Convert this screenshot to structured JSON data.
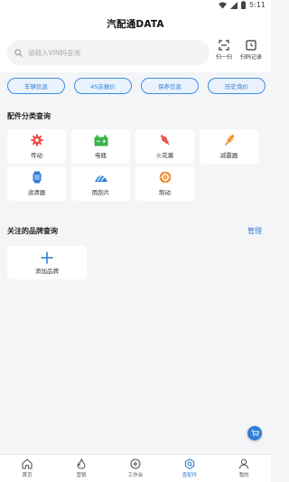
{
  "status_bar": {
    "time": "5:11"
  },
  "app": {
    "title": "汽配通DATA"
  },
  "search": {
    "placeholder": "请输入VIN码查询"
  },
  "actions": {
    "scan_label": "扫一扫",
    "scan_history_label": "扫码记录"
  },
  "quick_chips": [
    "车辆信息",
    "4S店报价",
    "保养信息",
    "历史询价"
  ],
  "categories_section": {
    "title": "配件分类查询",
    "items": [
      {
        "label": "传动",
        "icon": "gear-icon",
        "color": "#e8544a"
      },
      {
        "label": "电瓶",
        "icon": "battery-icon",
        "color": "#3cb44b"
      },
      {
        "label": "火花塞",
        "icon": "spark-plug-icon",
        "color": "#e8544a"
      },
      {
        "label": "减震器",
        "icon": "shock-absorber-icon",
        "color": "#f08a24"
      },
      {
        "label": "滤清器",
        "icon": "filter-icon",
        "color": "#2f7fd8"
      },
      {
        "label": "雨刮片",
        "icon": "wiper-icon",
        "color": "#2f7fd8"
      },
      {
        "label": "制动",
        "icon": "brake-disc-icon",
        "color": "#f08a24"
      }
    ]
  },
  "brands_section": {
    "title": "关注的品牌查询",
    "manage_label": "管理",
    "add_label": "添加品牌"
  },
  "bottom_nav": [
    {
      "label": "首页",
      "icon": "home-icon",
      "active": false
    },
    {
      "label": "营销",
      "icon": "flame-icon",
      "active": false
    },
    {
      "label": "工作台",
      "icon": "plus-circle-icon",
      "active": false
    },
    {
      "label": "查配件",
      "icon": "search-parts-icon",
      "active": true
    },
    {
      "label": "我的",
      "icon": "user-icon",
      "active": false
    }
  ],
  "colors": {
    "accent": "#2f7fd8",
    "background": "#f4f5f7"
  }
}
